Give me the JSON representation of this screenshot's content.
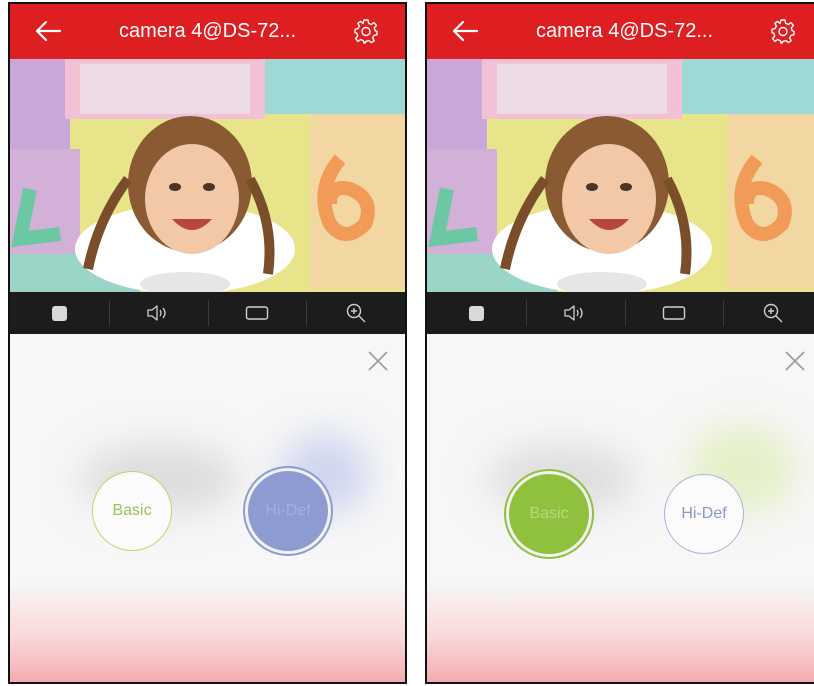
{
  "screens": [
    {
      "title": "camera 4@DS-72...",
      "quality_options": {
        "basic_label": "Basic",
        "hidef_label": "Hi-Def",
        "selected": "Hi-Def"
      }
    },
    {
      "title": "camera 4@DS-72...",
      "quality_options": {
        "basic_label": "Basic",
        "hidef_label": "Hi-Def",
        "selected": "Basic"
      }
    }
  ],
  "icons": {
    "back": "arrow-left-icon",
    "settings": "gear-icon",
    "stop": "stop-icon",
    "audio": "speaker-icon",
    "window": "window-icon",
    "zoom": "zoom-in-icon",
    "close": "close-icon"
  },
  "colors": {
    "header": "#dd1f22",
    "toolbar": "#1c1c1c",
    "basic_accent": "#8fc13f",
    "hidef_accent": "#8e9bd3"
  }
}
